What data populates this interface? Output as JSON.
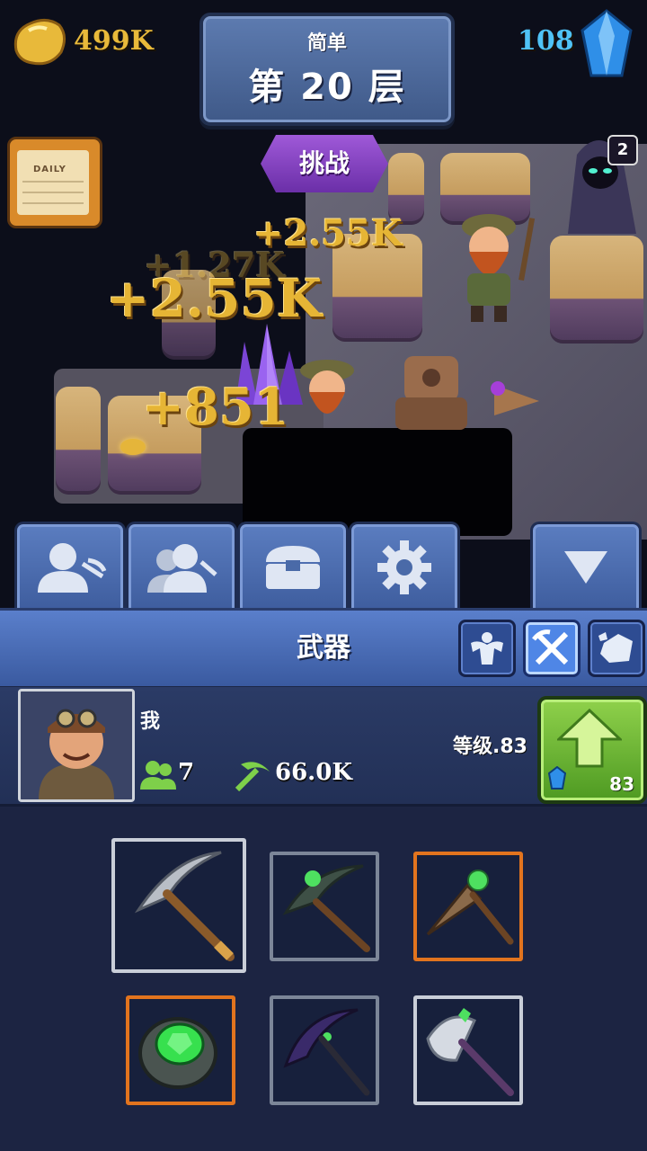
{
  "resources": {
    "gold": "499K",
    "gems": "108"
  },
  "level": {
    "difficulty": "简单",
    "floor": "第 20 层"
  },
  "challenge_label": "挑战",
  "daily_label": "DAILY",
  "enemy_badge": "2",
  "floating_texts": [
    "+2.55K",
    "+1.27K",
    "+2.55K",
    "+851"
  ],
  "nav_tabs": [
    {
      "icon": "miner-profile-icon"
    },
    {
      "icon": "miners-group-icon"
    },
    {
      "icon": "chest-icon"
    },
    {
      "icon": "gear-icon"
    },
    {
      "icon": "collapse-down-icon"
    }
  ],
  "section": {
    "title": "武器",
    "categories": [
      {
        "icon": "strength-icon",
        "active": false
      },
      {
        "icon": "crossed-tools-icon",
        "active": true
      },
      {
        "icon": "ore-rock-icon",
        "active": false
      }
    ]
  },
  "player": {
    "name": "我",
    "workers": "7",
    "power": "66.0K",
    "level_text": "等级.83",
    "upgrade_cost": "83"
  },
  "colors": {
    "gold_text": "#e8b93a",
    "gem_text": "#4fc3f7",
    "rarity_common": "#c9ced8",
    "rarity_uncommon": "#7c8698",
    "rarity_rare": "#e2741e"
  },
  "inventory": [
    {
      "icon": "iron-pickaxe-icon",
      "rarity": "white",
      "selected": true
    },
    {
      "icon": "emerald-pickaxe-icon",
      "rarity": "gray",
      "selected": false
    },
    {
      "icon": "emerald-drill-icon",
      "rarity": "orange",
      "selected": false
    },
    {
      "icon": "emerald-ring-icon",
      "rarity": "orange",
      "selected": false
    },
    {
      "icon": "dark-scythe-icon",
      "rarity": "gray",
      "selected": false
    },
    {
      "icon": "battle-axe-icon",
      "rarity": "white",
      "selected": false
    }
  ]
}
